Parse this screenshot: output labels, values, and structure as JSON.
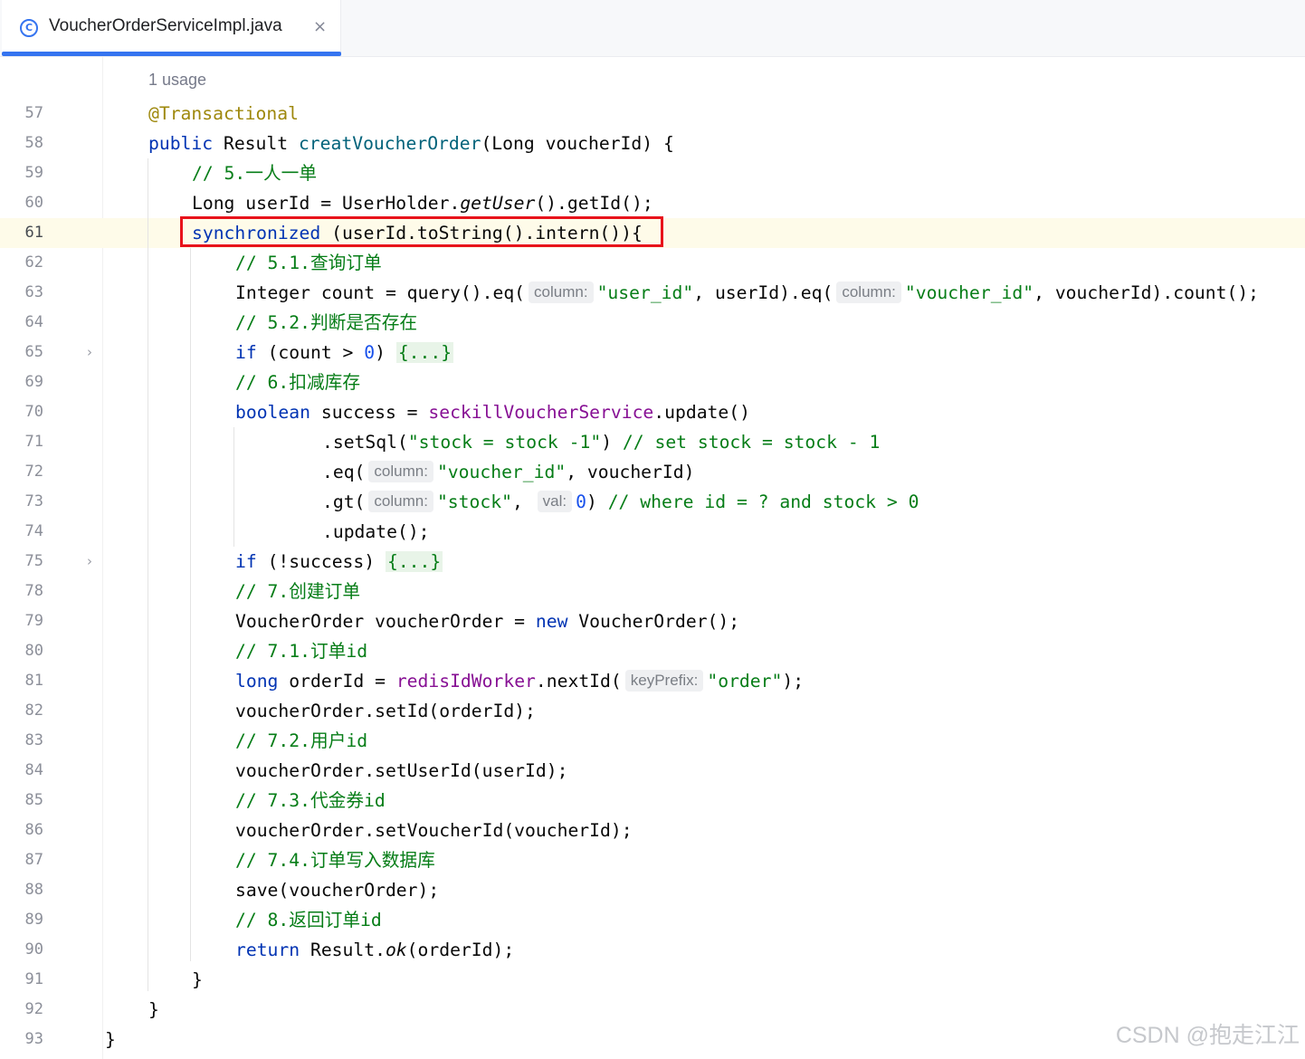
{
  "tab": {
    "title": "VoucherOrderServiceImpl.java",
    "icon": "class-icon",
    "close_glyph": "×",
    "class_glyph": "C"
  },
  "editor": {
    "usage_hint": "1 usage",
    "hints": {
      "column": "column:",
      "val": "val:",
      "keyPrefix": "keyPrefix:"
    },
    "lines": [
      {
        "number": "57",
        "text": "@Transactional"
      },
      {
        "number": "58",
        "text": "public Result creatVoucherOrder(Long voucherId) {"
      },
      {
        "number": "59",
        "text": "// 5.一人一单"
      },
      {
        "number": "60",
        "text": "Long userId = UserHolder.getUser().getId();"
      },
      {
        "number": "61",
        "text": "synchronized (userId.toString().intern()){"
      },
      {
        "number": "62",
        "text": "// 5.1.查询订单"
      },
      {
        "number": "63",
        "text": "Integer count = query().eq(column: \"user_id\", userId).eq(column: \"voucher_id\", voucherId).count();"
      },
      {
        "number": "64",
        "text": "// 5.2.判断是否存在"
      },
      {
        "number": "65",
        "text": "if (count > 0) {...}"
      },
      {
        "number": "69",
        "text": "// 6.扣减库存"
      },
      {
        "number": "70",
        "text": "boolean success = seckillVoucherService.update()"
      },
      {
        "number": "71",
        "text": ".setSql(\"stock = stock -1\") // set stock = stock - 1"
      },
      {
        "number": "72",
        "text": ".eq(column: \"voucher_id\", voucherId)"
      },
      {
        "number": "73",
        "text": ".gt(column: \"stock\", val: 0) // where id = ? and stock > 0"
      },
      {
        "number": "74",
        "text": ".update();"
      },
      {
        "number": "75",
        "text": "if (!success) {...}"
      },
      {
        "number": "78",
        "text": "// 7.创建订单"
      },
      {
        "number": "79",
        "text": "VoucherOrder voucherOrder = new VoucherOrder();"
      },
      {
        "number": "80",
        "text": "// 7.1.订单id"
      },
      {
        "number": "81",
        "text": "long orderId = redisIdWorker.nextId(keyPrefix: \"order\");"
      },
      {
        "number": "82",
        "text": "voucherOrder.setId(orderId);"
      },
      {
        "number": "83",
        "text": "// 7.2.用户id"
      },
      {
        "number": "84",
        "text": "voucherOrder.setUserId(userId);"
      },
      {
        "number": "85",
        "text": "// 7.3.代金券id"
      },
      {
        "number": "86",
        "text": "voucherOrder.setVoucherId(voucherId);"
      },
      {
        "number": "87",
        "text": "// 7.4.订单写入数据库"
      },
      {
        "number": "88",
        "text": "save(voucherOrder);"
      },
      {
        "number": "89",
        "text": "// 8.返回订单id"
      },
      {
        "number": "90",
        "text": "return Result.ok(orderId);"
      },
      {
        "number": "91",
        "text": "}"
      },
      {
        "number": "92",
        "text": "}"
      },
      {
        "number": "93",
        "text": "}"
      }
    ],
    "folded_placeholder": "{...}",
    "fold_icon": "chevron-right-icon",
    "current_line": "61"
  },
  "watermark": "CSDN @抱走江江",
  "colors": {
    "keyword": "#0033b3",
    "annotation": "#9e880d",
    "string": "#067d17",
    "number": "#1750eb",
    "field": "#871094",
    "highlight_box": "#e8131b",
    "tab_accent": "#3574f0"
  }
}
